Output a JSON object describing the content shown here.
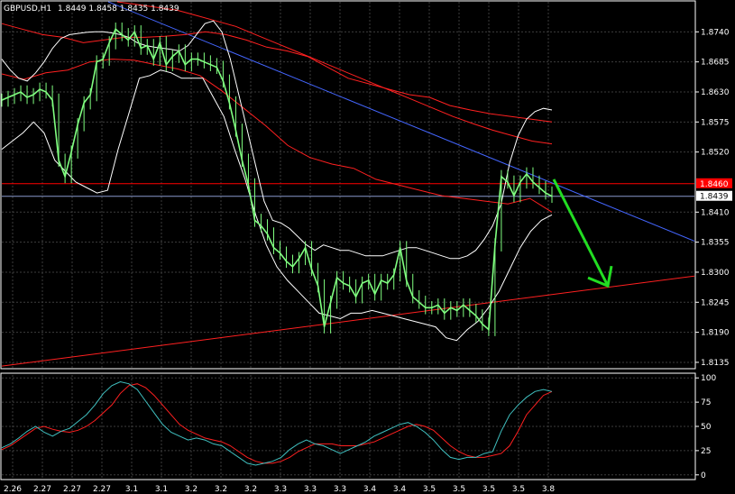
{
  "chart_data": {
    "type": "line",
    "header": {
      "symbol": "GBPUSD,H1",
      "ohlc": "1.8449 1.8458 1.8435 1.8439"
    },
    "colors": {
      "background": "#000000",
      "grid": "#3d3d3d",
      "frame": "#ffffff",
      "price": "#80ff80",
      "bollinger": "#ffffff",
      "ma": "#ff2020",
      "trend_blue": "#4466ff",
      "trend_red": "#ff2020",
      "arrow": "#22dd22",
      "osc_fast": "#40c0c0",
      "osc_slow": "#ff2020",
      "price_box": "#ff0000"
    },
    "x_labels": [
      "2.26",
      "2.27",
      "2.27",
      "2.27",
      "3.1",
      "3.1",
      "3.2",
      "3.2",
      "3.2",
      "3.3",
      "3.3",
      "3.3",
      "3.4",
      "3.4",
      "3.5",
      "3.5",
      "3.5",
      "3.5",
      "3.8"
    ],
    "main": {
      "ylim": [
        1.8125,
        1.8795
      ],
      "y_ticks": [
        "1.8740",
        "1.8685",
        "1.8630",
        "1.8575",
        "1.8520",
        "1.8410",
        "1.8355",
        "1.8300",
        "1.8245",
        "1.8190",
        "1.8135"
      ],
      "price": [
        1.8615,
        1.862,
        1.8625,
        1.863,
        1.862,
        1.8625,
        1.8635,
        1.863,
        1.8615,
        1.8505,
        1.8475,
        1.852,
        1.857,
        1.861,
        1.8625,
        1.8685,
        1.869,
        1.872,
        1.8745,
        1.8735,
        1.8725,
        1.874,
        1.871,
        1.8715,
        1.869,
        1.872,
        1.868,
        1.8695,
        1.8705,
        1.868,
        1.869,
        1.869,
        1.8685,
        1.868,
        1.8675,
        1.865,
        1.861,
        1.856,
        1.8505,
        1.846,
        1.8395,
        1.8385,
        1.837,
        1.8345,
        1.8335,
        1.832,
        1.831,
        1.8325,
        1.8345,
        1.8305,
        1.8275,
        1.82,
        1.8245,
        1.829,
        1.828,
        1.8275,
        1.8255,
        1.828,
        1.8285,
        1.826,
        1.8285,
        1.828,
        1.8295,
        1.8345,
        1.8285,
        1.8255,
        1.8245,
        1.8235,
        1.8235,
        1.824,
        1.8225,
        1.8235,
        1.823,
        1.824,
        1.823,
        1.822,
        1.8205,
        1.8195,
        1.835,
        1.8475,
        1.8465,
        1.844,
        1.8465,
        1.848,
        1.8465,
        1.8455,
        1.8445,
        1.8439
      ],
      "bb_upper": [
        1.869,
        1.867,
        1.8655,
        1.865,
        1.8665,
        1.8685,
        1.871,
        1.8728,
        1.8735,
        1.8737,
        1.8739,
        1.874,
        1.874,
        1.8738,
        1.8735,
        1.873,
        1.872,
        1.8715,
        1.8712,
        1.871,
        1.8708,
        1.8705,
        1.8715,
        1.8735,
        1.8755,
        1.876,
        1.874,
        1.869,
        1.8625,
        1.856,
        1.8495,
        1.843,
        1.8395,
        1.839,
        1.838,
        1.8365,
        1.835,
        1.834,
        1.835,
        1.8345,
        1.834,
        1.834,
        1.8335,
        1.833,
        1.833,
        1.833,
        1.8335,
        1.834,
        1.8345,
        1.8345,
        1.834,
        1.8335,
        1.833,
        1.8325,
        1.8325,
        1.833,
        1.834,
        1.836,
        1.8385,
        1.8425,
        1.85,
        1.855,
        1.858,
        1.8594,
        1.86,
        1.8597
      ],
      "bb_lower": [
        1.8525,
        1.854,
        1.8555,
        1.8575,
        1.8555,
        1.8505,
        1.8485,
        1.8465,
        1.8455,
        1.8445,
        1.845,
        1.8525,
        1.859,
        1.8655,
        1.866,
        1.867,
        1.8665,
        1.8655,
        1.8655,
        1.8655,
        1.862,
        1.8585,
        1.8525,
        1.847,
        1.8405,
        1.835,
        1.831,
        1.8285,
        1.8265,
        1.8245,
        1.8225,
        1.822,
        1.8215,
        1.8225,
        1.8225,
        1.823,
        1.8225,
        1.822,
        1.8215,
        1.821,
        1.8205,
        1.82,
        1.818,
        1.8175,
        1.8195,
        1.821,
        1.8235,
        1.8265,
        1.8305,
        1.8345,
        1.8375,
        1.8395,
        1.8405
      ],
      "ma_upper": [
        1.8755,
        1.8745,
        1.8735,
        1.873,
        1.872,
        1.8725,
        1.873,
        1.873,
        1.8732,
        1.8735,
        1.874,
        1.8735,
        1.8725,
        1.8712,
        1.8705,
        1.8695,
        1.8675,
        1.8655,
        1.8645,
        1.8635,
        1.8625,
        1.862,
        1.8605,
        1.8597,
        1.859,
        1.8585,
        1.858,
        1.8575
      ],
      "ma_mid": [
        1.8795,
        1.879,
        1.8785,
        1.878,
        1.877,
        1.876,
        1.875,
        1.8735,
        1.872,
        1.8705,
        1.869,
        1.8675,
        1.866,
        1.8645,
        1.863,
        1.8615,
        1.86,
        1.8585,
        1.8572,
        1.856,
        1.855,
        1.854,
        1.8535
      ],
      "ma_lower": [
        1.8663,
        1.8653,
        1.8665,
        1.867,
        1.8685,
        1.869,
        1.8688,
        1.868,
        1.8672,
        1.866,
        1.8632,
        1.86,
        1.8568,
        1.8532,
        1.851,
        1.8498,
        1.849,
        1.847,
        1.846,
        1.845,
        1.844,
        1.8435,
        1.843,
        1.8425,
        1.8435,
        1.841
      ],
      "hline_red": 1.8462,
      "hline_blue": 1.8439,
      "price_box_red": "1.8460",
      "price_box_white": "1.8439"
    },
    "oscillator": {
      "ylim": [
        -3,
        103
      ],
      "y_ticks": [
        "100",
        "75",
        "50",
        "25",
        "0"
      ],
      "fast": [
        28,
        32,
        38,
        45,
        50,
        44,
        40,
        45,
        48,
        55,
        62,
        72,
        84,
        92,
        96,
        94,
        88,
        76,
        64,
        52,
        44,
        40,
        36,
        38,
        36,
        32,
        30,
        24,
        18,
        12,
        10,
        12,
        14,
        18,
        26,
        32,
        36,
        32,
        30,
        26,
        22,
        26,
        30,
        34,
        40,
        44,
        48,
        52,
        54,
        50,
        44,
        36,
        26,
        18,
        16,
        18,
        18,
        22,
        24,
        45,
        62,
        72,
        80,
        86,
        88,
        86
      ],
      "slow": [
        26,
        30,
        36,
        42,
        48,
        50,
        47,
        45,
        44,
        46,
        50,
        56,
        64,
        72,
        84,
        92,
        94,
        90,
        82,
        72,
        62,
        52,
        46,
        42,
        38,
        36,
        34,
        30,
        24,
        18,
        14,
        12,
        12,
        14,
        18,
        24,
        28,
        32,
        32,
        32,
        30,
        30,
        30,
        32,
        34,
        38,
        42,
        46,
        50,
        52,
        50,
        46,
        38,
        30,
        24,
        20,
        18,
        18,
        20,
        22,
        30,
        45,
        62,
        72,
        82,
        86
      ]
    }
  }
}
